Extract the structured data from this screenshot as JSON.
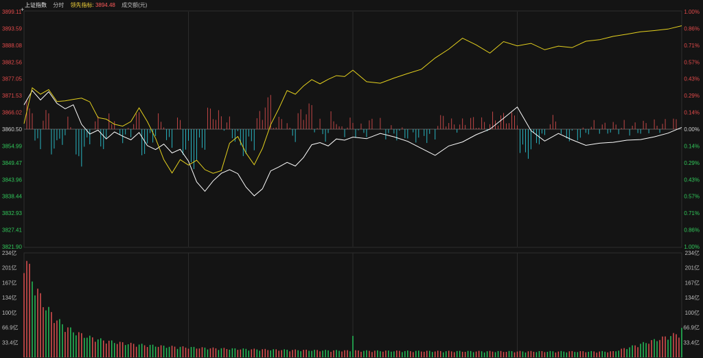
{
  "header": {
    "index_name": "上证指数",
    "period": "分时",
    "lead_label": "领先指标:",
    "lead_value": "3894.48",
    "amount_label": "成交额(元)"
  },
  "colors": {
    "background": "#141414",
    "price_line": "#ffffff",
    "lead_line": "#e6d21e",
    "up": "#ff4d4d",
    "down": "#2ec8d4",
    "vol_up": "#e05050",
    "vol_down": "#25c25a",
    "grid": "#2a2a2a",
    "axis_up_text": "#e24a4a",
    "axis_down_text": "#31c85a",
    "axis_mid_text": "#cfcfcf"
  },
  "chart_data": {
    "type": "line",
    "y_left_ticks": [
      "3899.11",
      "3893.59",
      "3888.08",
      "3882.56",
      "3877.05",
      "3871.53",
      "3866.02",
      "3860.50",
      "3854.99",
      "3849.47",
      "3843.96",
      "3838.44",
      "3832.93",
      "3827.41",
      "3821.90"
    ],
    "y_right_ticks": [
      "1.00%",
      "0.86%",
      "0.71%",
      "0.57%",
      "0.43%",
      "0.29%",
      "0.14%",
      "0.00%",
      "0.14%",
      "0.29%",
      "0.43%",
      "0.57%",
      "0.71%",
      "0.86%",
      "1.00%"
    ],
    "ylim": [
      3821.9,
      3899.11
    ],
    "prev_close": 3860.5,
    "session_minutes": 240,
    "series": [
      {
        "name": "上证指数",
        "x": [
          0,
          3,
          6,
          9,
          12,
          15,
          18,
          21,
          24,
          27,
          30,
          33,
          36,
          39,
          42,
          45,
          48,
          51,
          54,
          57,
          60,
          63,
          66,
          69,
          72,
          75,
          78,
          81,
          84,
          87,
          90,
          93,
          96,
          99,
          102,
          105,
          108,
          111,
          114,
          117,
          120,
          125,
          130,
          135,
          140,
          145,
          150,
          155,
          160,
          165,
          170,
          175,
          180,
          185,
          190,
          195,
          200,
          205,
          210,
          215,
          220,
          225,
          230,
          235,
          240
        ],
        "values": [
          3868.5,
          3873.2,
          3870.1,
          3872.8,
          3869.0,
          3867.2,
          3868.5,
          3862.1,
          3858.9,
          3860.2,
          3857.3,
          3859.6,
          3858.2,
          3857.0,
          3859.4,
          3855.1,
          3853.8,
          3855.6,
          3852.7,
          3853.9,
          3850.0,
          3843.2,
          3840.1,
          3843.5,
          3846.0,
          3847.2,
          3845.9,
          3841.5,
          3838.6,
          3840.9,
          3846.8,
          3848.1,
          3849.6,
          3848.4,
          3851.2,
          3855.4,
          3856.1,
          3855.0,
          3857.3,
          3856.9,
          3857.9,
          3857.4,
          3859.1,
          3858.0,
          3856.5,
          3854.2,
          3851.9,
          3855.0,
          3856.3,
          3858.7,
          3860.5,
          3864.1,
          3867.8,
          3860.0,
          3856.6,
          3859.1,
          3857.0,
          3855.2,
          3855.9,
          3856.2,
          3856.9,
          3857.1,
          3858.0,
          3859.2,
          3861.1
        ]
      },
      {
        "name": "领先指标",
        "x": [
          0,
          3,
          6,
          9,
          12,
          15,
          18,
          21,
          24,
          27,
          30,
          33,
          36,
          39,
          42,
          45,
          48,
          51,
          54,
          57,
          60,
          63,
          66,
          69,
          72,
          75,
          78,
          81,
          84,
          87,
          90,
          93,
          96,
          99,
          102,
          105,
          108,
          111,
          114,
          117,
          120,
          125,
          130,
          135,
          140,
          145,
          150,
          155,
          160,
          165,
          170,
          175,
          180,
          185,
          190,
          195,
          200,
          205,
          210,
          215,
          220,
          225,
          230,
          235,
          240
        ],
        "values": [
          3862.3,
          3874.1,
          3872.0,
          3873.5,
          3869.6,
          3869.8,
          3870.3,
          3870.7,
          3869.5,
          3864.3,
          3863.8,
          3862.1,
          3861.5,
          3863.0,
          3867.5,
          3863.0,
          3857.5,
          3850.5,
          3846.1,
          3850.5,
          3848.7,
          3850.3,
          3847.2,
          3846.0,
          3846.9,
          3855.9,
          3858.1,
          3852.7,
          3848.8,
          3854.2,
          3862.0,
          3867.3,
          3873.2,
          3872.0,
          3874.7,
          3876.8,
          3875.4,
          3876.9,
          3878.1,
          3877.8,
          3879.9,
          3876.1,
          3875.6,
          3877.3,
          3878.8,
          3880.2,
          3883.9,
          3886.8,
          3890.4,
          3888.2,
          3885.5,
          3889.3,
          3887.9,
          3888.7,
          3886.6,
          3887.8,
          3887.3,
          3889.4,
          3889.9,
          3891.0,
          3891.7,
          3892.5,
          3892.9,
          3893.4,
          3894.48
        ]
      }
    ],
    "volume_ticks": [
      "234亿",
      "201亿",
      "167亿",
      "134亿",
      "100亿",
      "66.9亿",
      "33.4亿"
    ],
    "volume_ylim": [
      0,
      234
    ],
    "volume_unit": "亿"
  }
}
